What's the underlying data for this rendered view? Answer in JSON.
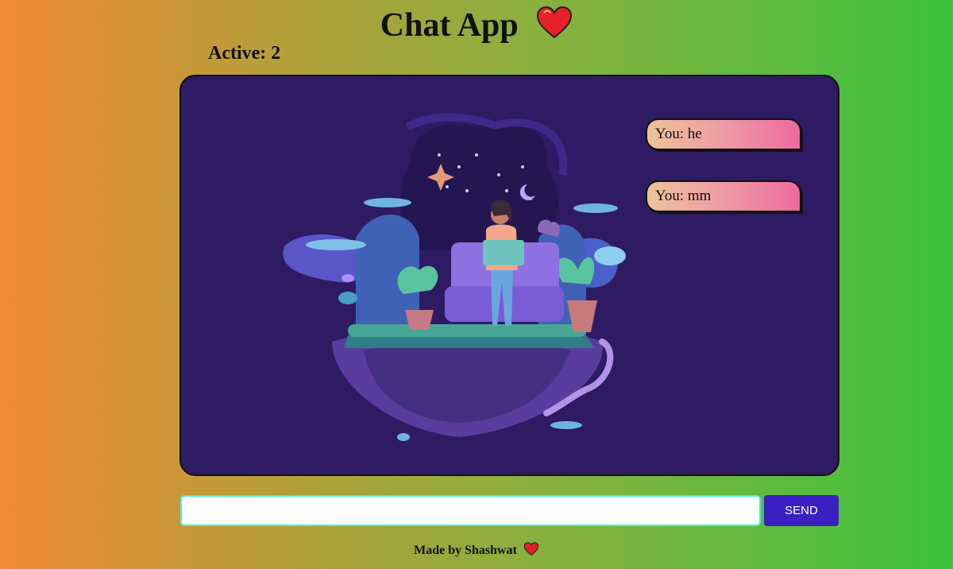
{
  "header": {
    "title": "Chat App",
    "title_icon": "heart-icon",
    "active_text": "Active: 2"
  },
  "messages": [
    {
      "text": "You: he"
    },
    {
      "text": "You: mm"
    }
  ],
  "composer": {
    "input_value": "",
    "input_placeholder": "",
    "send_label": "SEND"
  },
  "footer": {
    "text": "Made by Shashwat",
    "icon": "heart-icon"
  },
  "colors": {
    "chat_bg": "#2f1b64",
    "send_button": "#3a1fc2",
    "input_border": "#48f0d8",
    "heart": "#e8202a"
  }
}
